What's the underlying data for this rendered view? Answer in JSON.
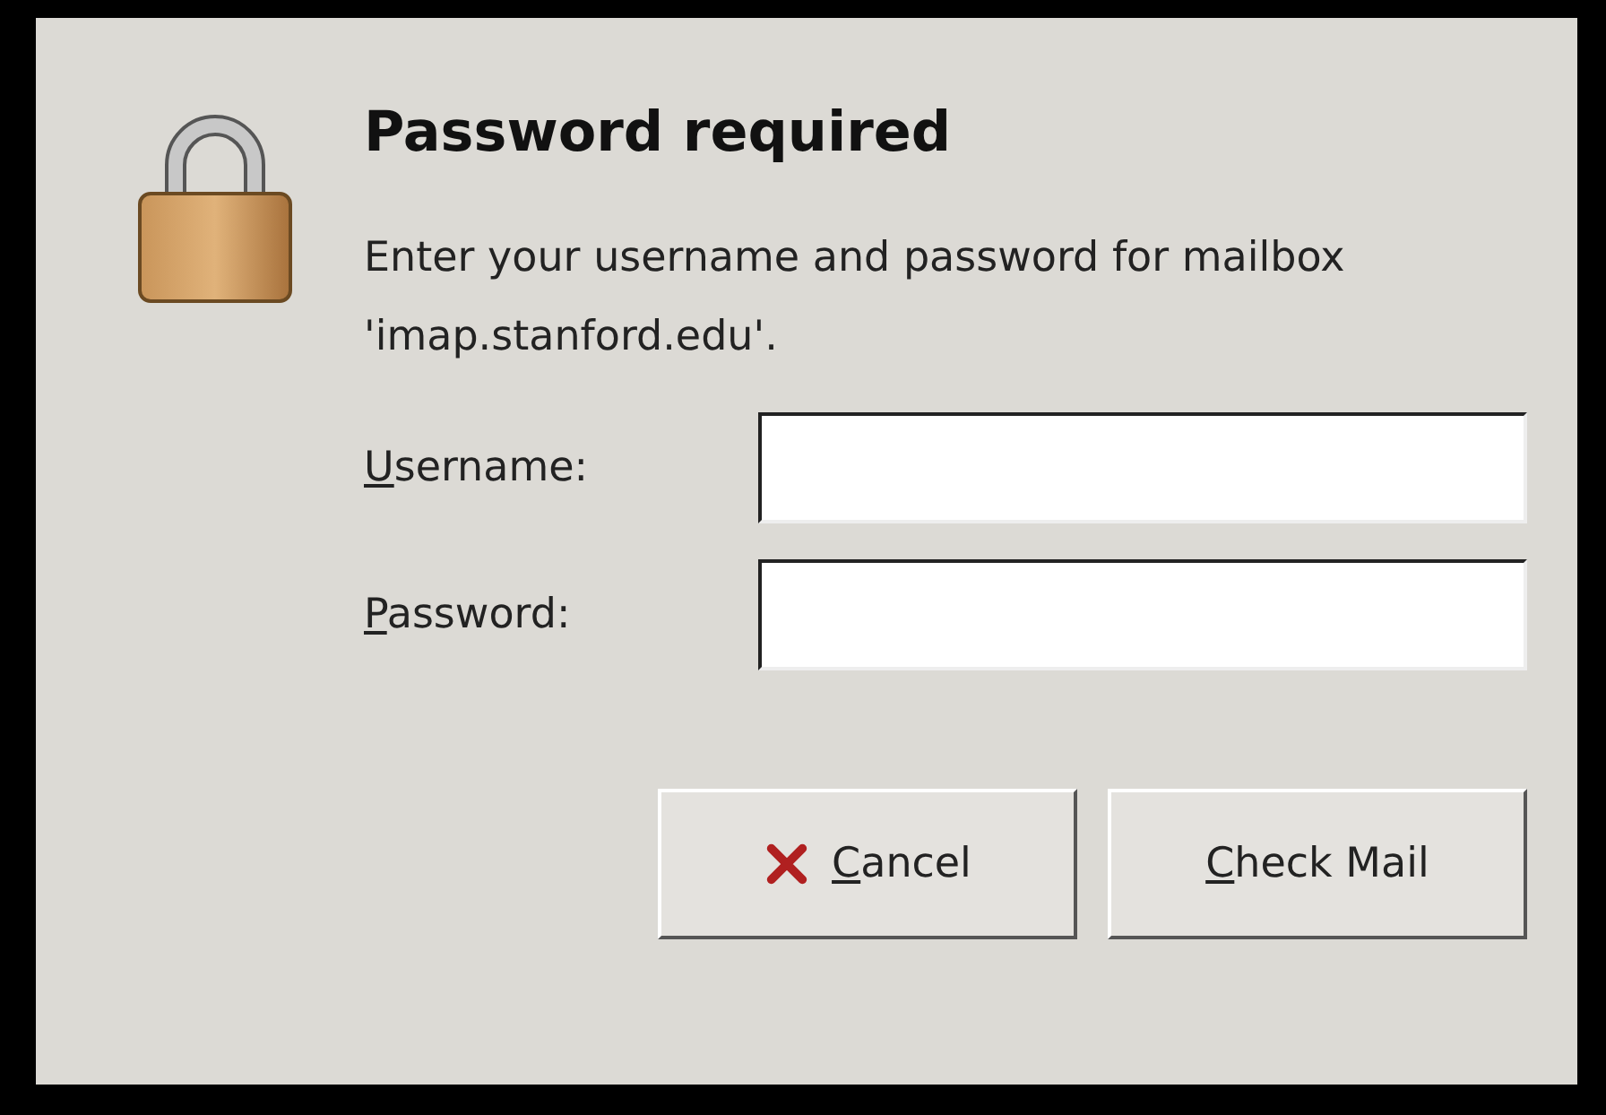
{
  "dialog": {
    "title": "Password required",
    "message": "Enter your username and password for mailbox 'imap.stanford.edu'.",
    "fields": [
      {
        "label": "Username:",
        "mnemonic_underlined": true
      },
      {
        "label": "Password:",
        "mnemonic_underlined": true
      }
    ],
    "buttons": [
      {
        "label": "Cancel",
        "kind": "cancel",
        "mnemonic_underlined": true
      },
      {
        "label": "Check Mail",
        "kind": "default",
        "mnemonic_underlined": true
      }
    ]
  }
}
